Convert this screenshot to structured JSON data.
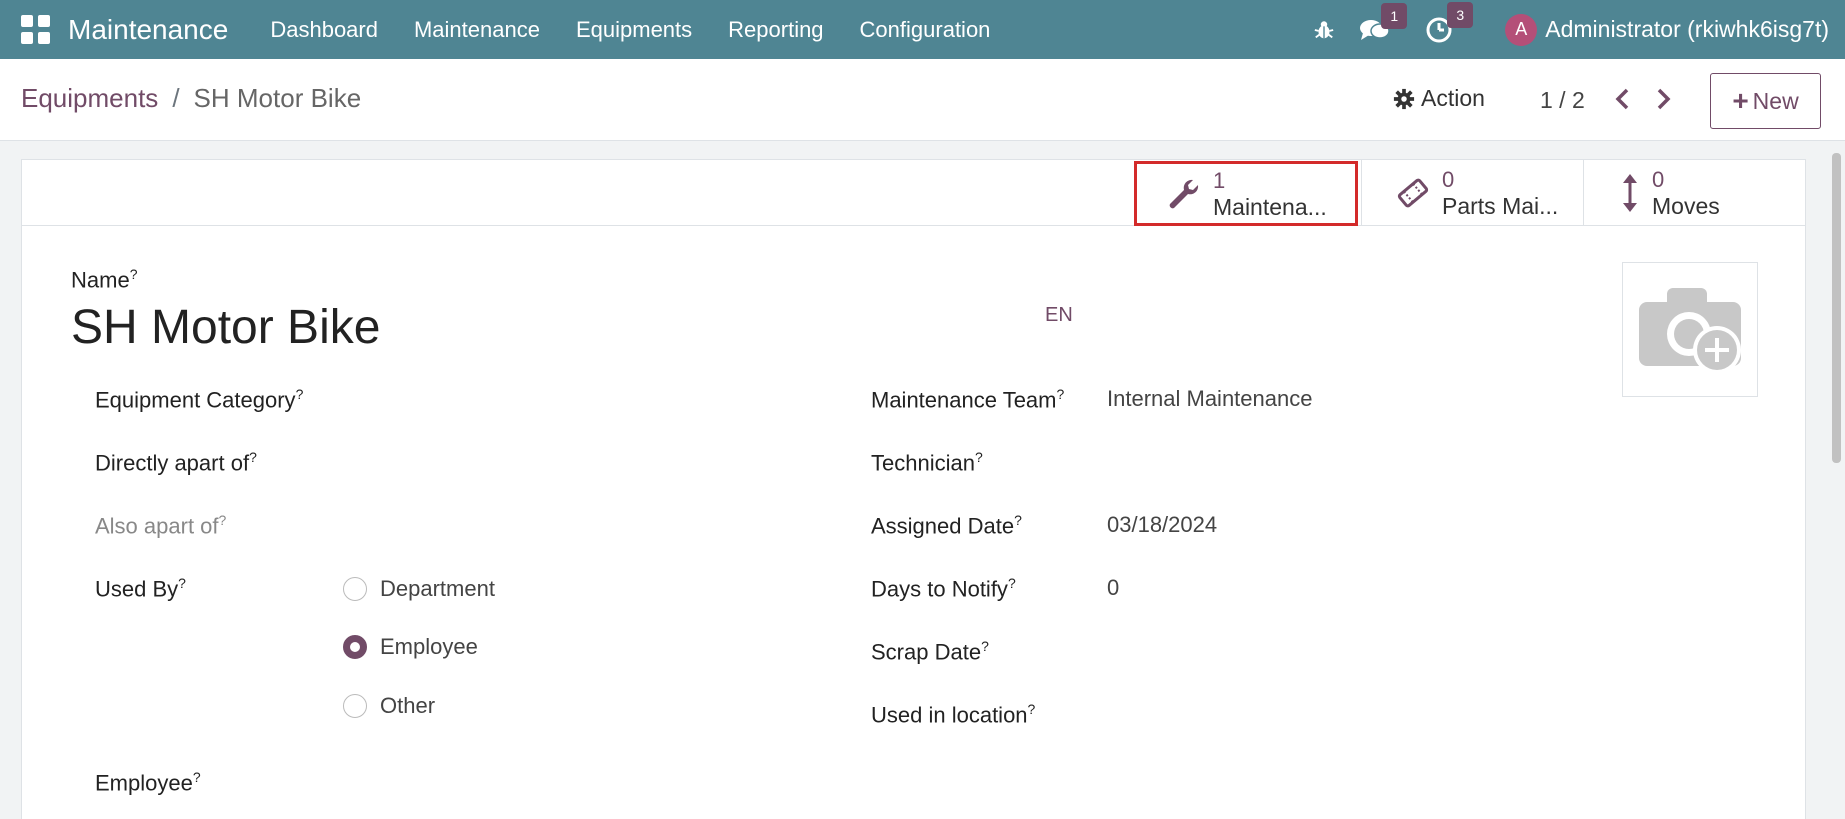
{
  "navbar": {
    "app_name": "Maintenance",
    "menu": [
      "Dashboard",
      "Maintenance",
      "Equipments",
      "Reporting",
      "Configuration"
    ],
    "messages_count": "1",
    "activities_count": "3",
    "avatar_letter": "A",
    "user": "Administrator (rkiwhk6isg7t)"
  },
  "breadcrumb": {
    "parent": "Equipments",
    "separator": "/",
    "current": "SH Motor Bike"
  },
  "toolbar": {
    "action_label": "Action",
    "pager": "1 / 2",
    "new_label": "New"
  },
  "stat_buttons": [
    {
      "value": "1",
      "label": "Maintena..."
    },
    {
      "value": "0",
      "label": "Parts Mai..."
    },
    {
      "value": "0",
      "label": "Moves"
    }
  ],
  "form": {
    "name_label": "Name",
    "name_value": "SH Motor Bike",
    "lang": "EN",
    "left": {
      "category_label": "Equipment Category",
      "directly_apart_label": "Directly apart of",
      "also_apart_label": "Also apart of",
      "used_by_label": "Used By",
      "used_by_options": [
        "Department",
        "Employee",
        "Other"
      ],
      "used_by_selected": "Employee",
      "employee_label": "Employee"
    },
    "right": {
      "team_label": "Maintenance Team",
      "team_value": "Internal Maintenance",
      "technician_label": "Technician",
      "assigned_date_label": "Assigned Date",
      "assigned_date_value": "03/18/2024",
      "days_notify_label": "Days to Notify",
      "days_notify_value": "0",
      "scrap_date_label": "Scrap Date",
      "used_location_label": "Used in location"
    },
    "help_marker": "?"
  },
  "colors": {
    "navbar": "#4f8593",
    "accent": "#714b67",
    "highlight": "#d32a2a"
  }
}
